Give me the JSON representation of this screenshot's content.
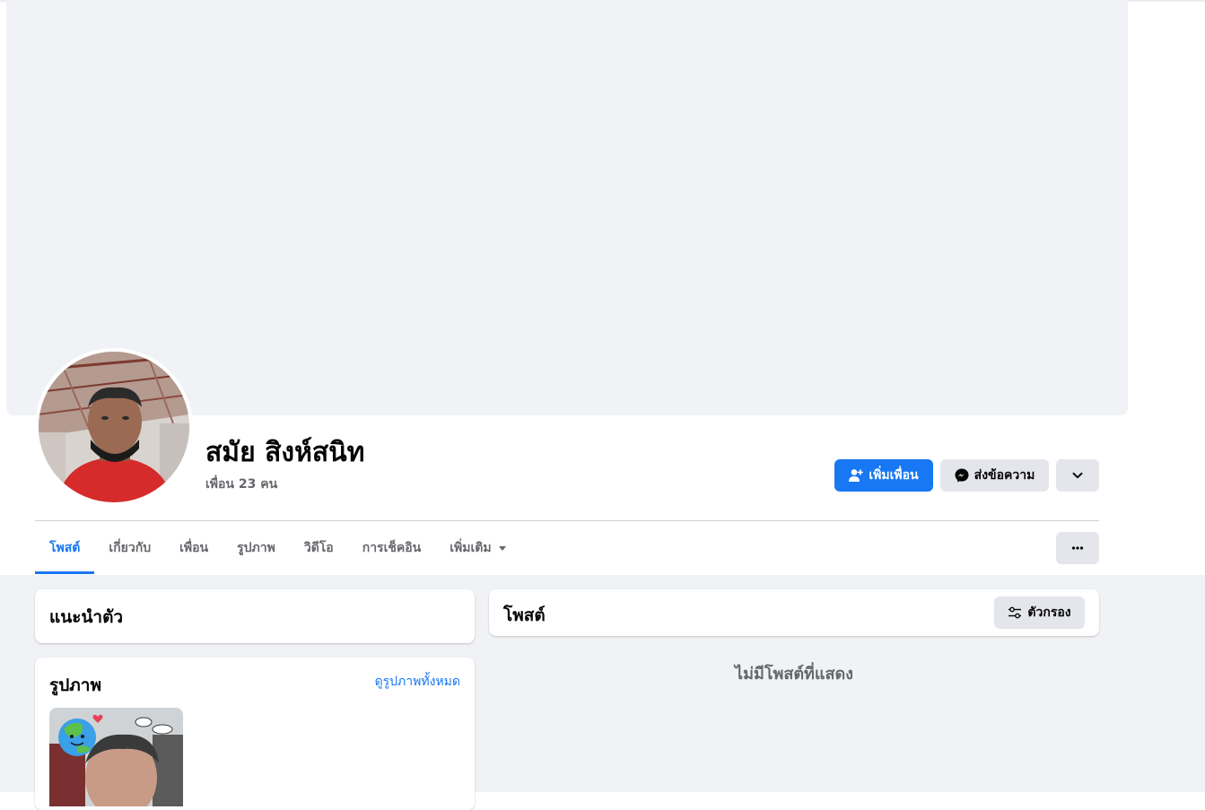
{
  "profile": {
    "name": "สมัย สิงห์สนิท",
    "friend_count": "เพื่อน 23 คน"
  },
  "actions": {
    "add_friend_label": "เพิ่มเพื่อน",
    "message_label": "ส่งข้อความ"
  },
  "tabs": [
    {
      "label": "โพสต์",
      "active": true
    },
    {
      "label": "เกี่ยวกับ",
      "active": false
    },
    {
      "label": "เพื่อน",
      "active": false
    },
    {
      "label": "รูปภาพ",
      "active": false
    },
    {
      "label": "วิดีโอ",
      "active": false
    },
    {
      "label": "การเช็คอิน",
      "active": false
    },
    {
      "label": "เพิ่มเติม",
      "active": false
    }
  ],
  "intro": {
    "title": "แนะนำตัว"
  },
  "photos": {
    "title": "รูปภาพ",
    "see_all_label": "ดูรูปภาพทั้งหมด"
  },
  "posts": {
    "title": "โพสต์",
    "filter_label": "ตัวกรอง",
    "empty_message": "ไม่มีโพสต์ที่แสดง"
  },
  "colors": {
    "accent": "#1877f2",
    "secondary_button": "#e4e6eb",
    "background": "#f0f2f5",
    "muted_text": "#65676b"
  }
}
